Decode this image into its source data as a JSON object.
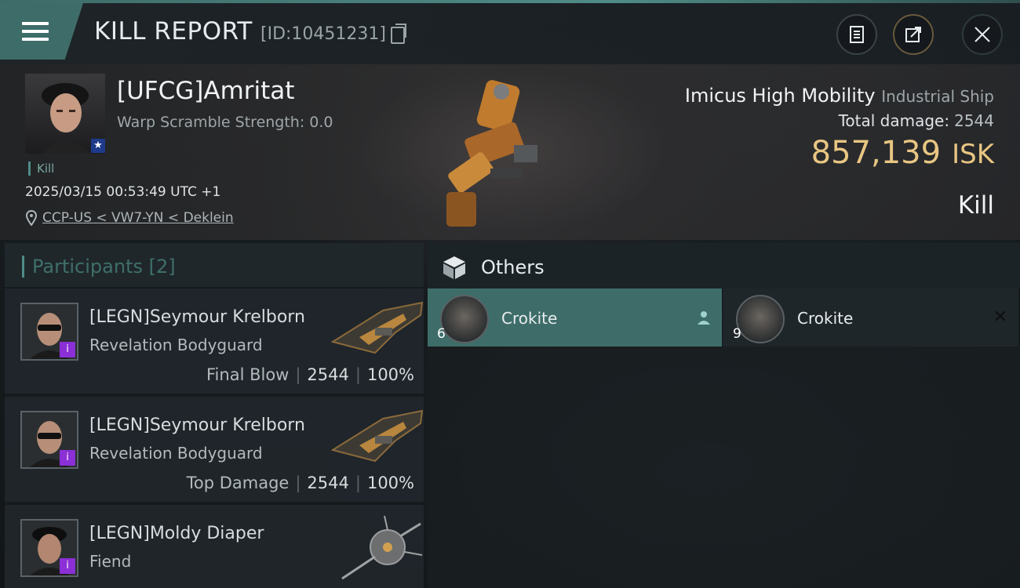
{
  "header": {
    "title": "KILL REPORT",
    "report_id": "[ID:10451231]",
    "icons": [
      "menu-icon",
      "copy-icon",
      "document-icon",
      "share-icon",
      "close-icon"
    ]
  },
  "victim": {
    "name": "[UFCG]Amritat",
    "warp_scramble": "Warp Scramble Strength: 0.0",
    "tag": "Kill",
    "timestamp": "2025/03/15 00:53:49 UTC +1",
    "location": "CCP-US < VW7-YN < Deklein",
    "ship_name": "Imicus High Mobility",
    "ship_class": "Industrial Ship",
    "total_damage_label": "Total damage:",
    "total_damage": "2544",
    "isk_value": "857,139",
    "isk_unit": "ISK",
    "result": "Kill"
  },
  "participants": {
    "title": "Participants [2]",
    "rows": [
      {
        "name": "[LEGN]Seymour Krelborn",
        "ship": "Revelation Bodyguard",
        "role": "Final Blow",
        "damage": "2544",
        "percent": "100%"
      },
      {
        "name": "[LEGN]Seymour Krelborn",
        "ship": "Revelation Bodyguard",
        "role": "Top Damage",
        "damage": "2544",
        "percent": "100%"
      },
      {
        "name": "[LEGN]Moldy Diaper",
        "ship": "Fiend",
        "role": "",
        "damage": "",
        "percent": ""
      }
    ]
  },
  "others": {
    "title": "Others",
    "items": [
      {
        "name": "Crokite",
        "qty": "6",
        "selected": true
      },
      {
        "name": "Crokite",
        "qty": "9",
        "selected": false
      }
    ]
  },
  "colors": {
    "accent": "#3e6d69",
    "isk": "#e8c682",
    "badge": "#8b2fd6"
  }
}
